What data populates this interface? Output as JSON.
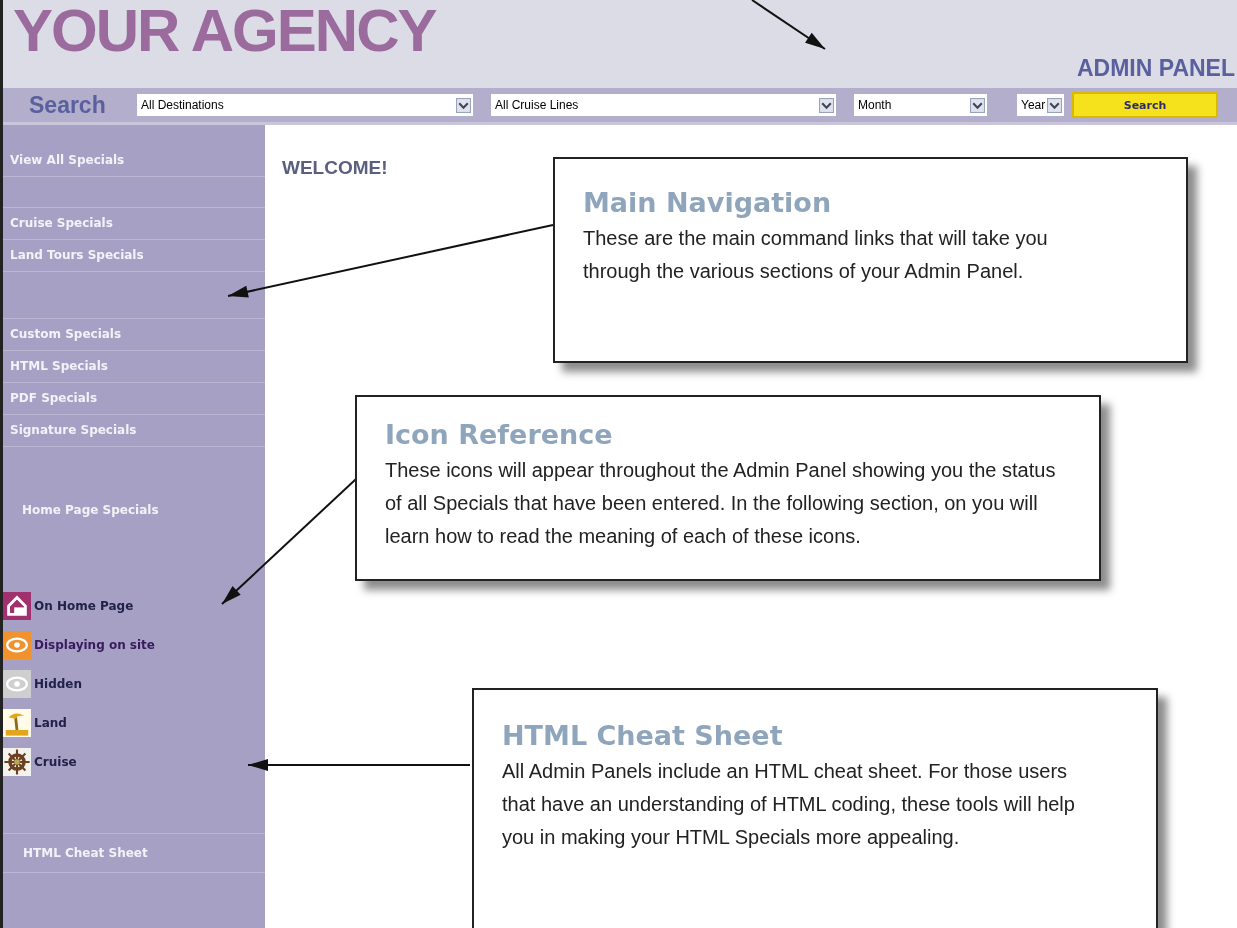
{
  "header": {
    "logo": "YOUR AGENCY",
    "panel_label": "ADMIN PANEL"
  },
  "search": {
    "label": "Search",
    "dropdowns": [
      "All Destinations",
      "All Cruise Lines",
      "Month",
      "Year"
    ],
    "button": "Search"
  },
  "sidebar": {
    "groups": [
      {
        "items": [
          "View All Specials"
        ]
      },
      {
        "items": [
          "Cruise Specials",
          "Land Tours Specials"
        ]
      },
      {
        "items": [
          "Custom Specials",
          "HTML Specials",
          "PDF Specials",
          "Signature Specials"
        ]
      }
    ],
    "heading": "Home Page Specials",
    "legend": [
      {
        "kind": "home",
        "label": "On Home Page"
      },
      {
        "kind": "display",
        "label": "Displaying on site"
      },
      {
        "kind": "hidden",
        "label": "Hidden"
      },
      {
        "kind": "land",
        "label": "Land"
      },
      {
        "kind": "cruise",
        "label": "Cruise"
      }
    ],
    "footer_link": "HTML Cheat Sheet"
  },
  "main": {
    "heading": "WELCOME!"
  },
  "callouts": [
    {
      "title": "Main Navigation",
      "body": "These are the main command links that will take you through the various sections of your Admin Panel."
    },
    {
      "title": "Icon Reference",
      "body": "These icons will appear throughout the Admin Panel showing you the status of all Specials that have been entered. In the following section, on you will learn how to read the meaning of each of these icons."
    },
    {
      "title": "HTML Cheat Sheet",
      "body": "All Admin Panels include an HTML cheat sheet. For those users that have an understanding of HTML coding, these tools will help you in making your HTML Specials more appealing."
    }
  ]
}
